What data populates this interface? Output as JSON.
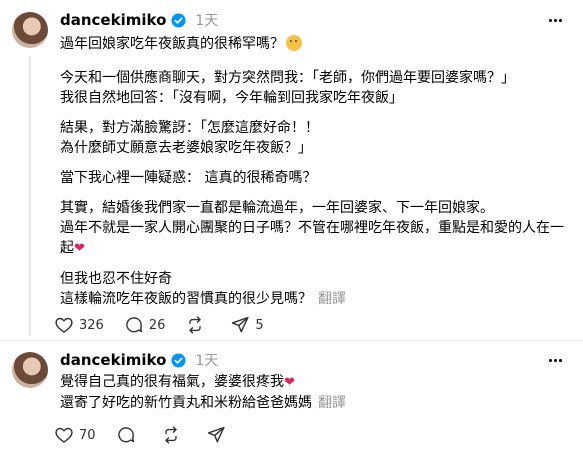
{
  "post1": {
    "username": "dancekimiko",
    "time": "1天",
    "title": "過年回娘家吃年夜飯真的很稀罕嗎？",
    "paragraphs": [
      [
        "今天和一個供應商聊天，對方突然問我：「老師，你們過年要回婆家嗎？」",
        "我很自然地回答：「沒有啊，今年輪到回我家吃年夜飯」"
      ],
      [
        "結果，對方滿臉驚訝：「怎麼這麼好命！！",
        "為什麼師丈願意去老婆娘家吃年夜飯？」"
      ],
      [
        "當下我心裡一陣疑惑： 這真的很稀奇嗎？"
      ],
      [
        "其實，結婚後我們家一直都是輪流過年，一年回婆家、下一年回娘家。",
        "過年不就是一家人開心團聚的日子嗎？不管在哪裡吃年夜飯，重點是和愛的人在一",
        "起"
      ],
      [
        "但我也忍不住好奇",
        "這樣輪流吃年夜飯的習慣真的很少見嗎？"
      ]
    ],
    "translate": "翻譯",
    "likes": "326",
    "comments": "26",
    "shares": "5"
  },
  "post2": {
    "username": "dancekimiko",
    "time": "1天",
    "line1": "覺得自己真的很有福氣，婆婆很疼我",
    "line2": "還寄了好吃的新竹貢丸和米粉給爸爸媽媽",
    "translate": "翻譯",
    "likes": "70"
  },
  "icons": {
    "verified": "verified-badge-icon",
    "like": "heart-outline-icon",
    "comment": "comment-bubble-icon",
    "repost": "repost-icon",
    "share": "send-icon",
    "more": "more-dots-icon"
  },
  "colors": {
    "verified": "#0095f6",
    "heart": "#e0245e",
    "muted": "#999999"
  }
}
